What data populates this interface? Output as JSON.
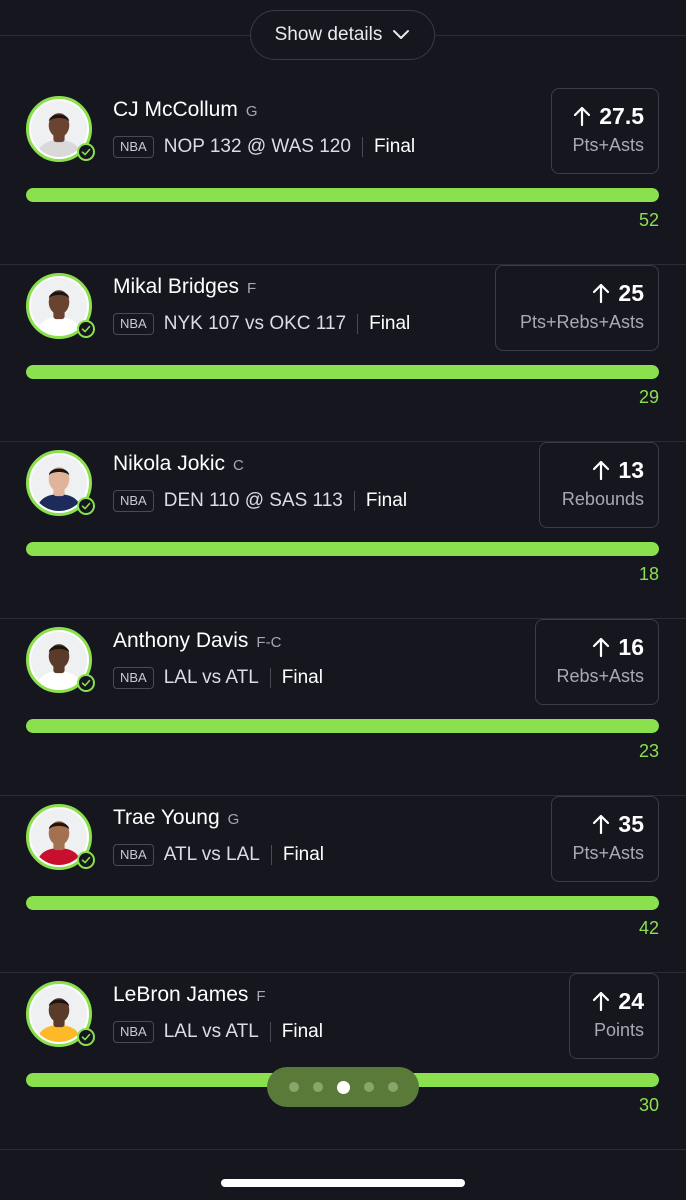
{
  "header": {
    "details_label": "Show details"
  },
  "picks": [
    {
      "name": "CJ McCollum",
      "position": "G",
      "league": "NBA",
      "matchup": "NOP 132 @ WAS 120",
      "status": "Final",
      "line_value": "27.5",
      "stat": "Pts+Asts",
      "actual": "52",
      "progress": 1.0,
      "avatar_skin": "#6b4431",
      "avatar_jersey": "#d9d9d9"
    },
    {
      "name": "Mikal Bridges",
      "position": "F",
      "league": "NBA",
      "matchup": "NYK 107 vs OKC 117",
      "status": "Final",
      "line_value": "25",
      "stat": "Pts+Rebs+Asts",
      "actual": "29",
      "progress": 1.0,
      "avatar_skin": "#6a4330",
      "avatar_jersey": "#ffffff"
    },
    {
      "name": "Nikola Jokic",
      "position": "C",
      "league": "NBA",
      "matchup": "DEN 110 @ SAS 113",
      "status": "Final",
      "line_value": "13",
      "stat": "Rebounds",
      "actual": "18",
      "progress": 1.0,
      "avatar_skin": "#e0b49a",
      "avatar_jersey": "#1d2b5a"
    },
    {
      "name": "Anthony Davis",
      "position": "F-C",
      "league": "NBA",
      "matchup": "LAL vs ATL",
      "status": "Final",
      "line_value": "16",
      "stat": "Rebs+Asts",
      "actual": "23",
      "progress": 1.0,
      "avatar_skin": "#5a3a28",
      "avatar_jersey": "#ffffff"
    },
    {
      "name": "Trae Young",
      "position": "G",
      "league": "NBA",
      "matchup": "ATL vs LAL",
      "status": "Final",
      "line_value": "35",
      "stat": "Pts+Asts",
      "actual": "42",
      "progress": 1.0,
      "avatar_skin": "#a37050",
      "avatar_jersey": "#c8102e"
    },
    {
      "name": "LeBron James",
      "position": "F",
      "league": "NBA",
      "matchup": "LAL vs ATL",
      "status": "Final",
      "line_value": "24",
      "stat": "Points",
      "actual": "30",
      "progress": 1.0,
      "avatar_skin": "#5a3a28",
      "avatar_jersey": "#fdb927"
    }
  ],
  "pager": {
    "count": 5,
    "active_index": 2
  },
  "colors": {
    "accent": "#8be04e",
    "background": "#16161e"
  }
}
